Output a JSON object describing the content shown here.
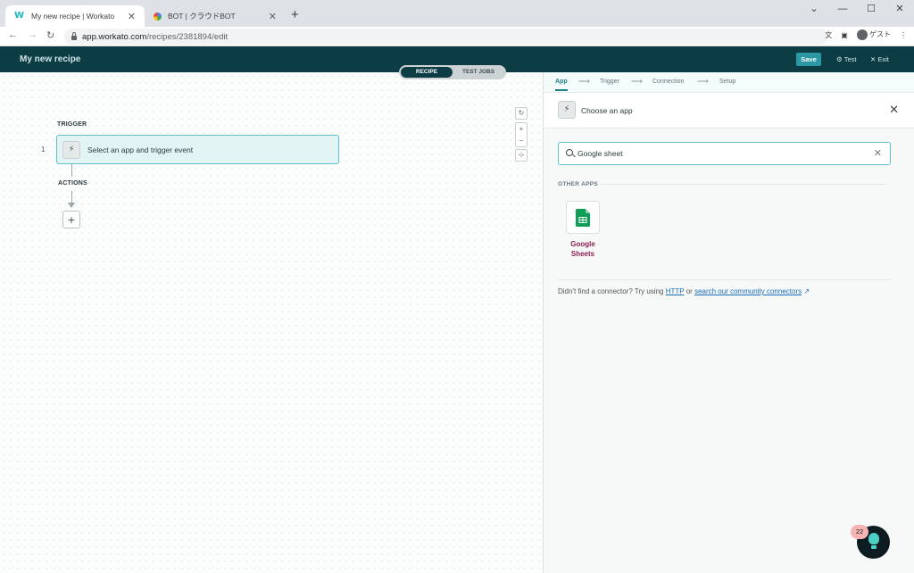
{
  "browser": {
    "tabs": [
      {
        "title": "My new recipe | Workato",
        "active": true
      },
      {
        "title": "BOT | クラウドBOT",
        "active": false
      }
    ],
    "url_host": "app.workato.com",
    "url_path": "/recipes/2381894/edit",
    "profile_label": "ゲスト"
  },
  "header": {
    "recipe_title": "My new recipe",
    "save_label": "Save",
    "test_label": "Test",
    "exit_label": "Exit"
  },
  "toggle": {
    "recipe_label": "RECIPE",
    "test_jobs_label": "TEST JOBS"
  },
  "canvas": {
    "trigger_label": "TRIGGER",
    "step_number": "1",
    "trigger_text": "Select an app and trigger event",
    "actions_label": "ACTIONS"
  },
  "panel": {
    "steps": [
      "App",
      "Trigger",
      "Connection",
      "Setup"
    ],
    "choose_title": "Choose an app",
    "search_value": "Google sheet",
    "section_label": "OTHER APPS",
    "apps": [
      {
        "name_line1": "Google",
        "name_line2": "Sheets"
      }
    ],
    "notfound_prefix": "Didn't find a connector? Try using",
    "notfound_http": "HTTP",
    "notfound_or": "or",
    "notfound_community": "search our community connectors"
  },
  "help": {
    "badge_count": "22"
  },
  "colors": {
    "header_bg": "#0c3d45",
    "accent": "#2c98a6",
    "app_name": "#8d1e4f",
    "sheets_green": "#0f9d58"
  }
}
